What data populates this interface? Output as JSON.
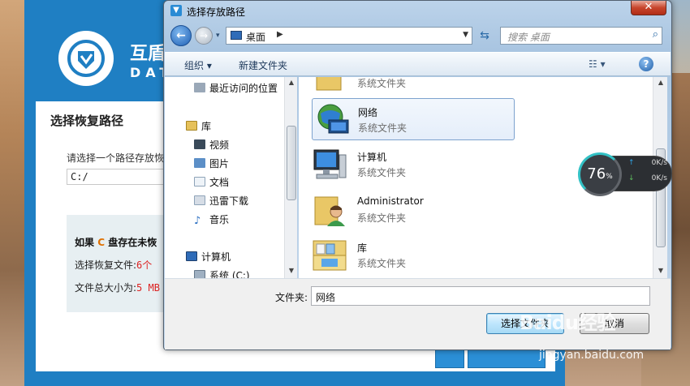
{
  "background_app": {
    "brand_title": "互盾",
    "brand_sub": "DAT",
    "panel_title": "选择恢复路径",
    "prompt": "请选择一个路径存放恢",
    "path_value": "C:/",
    "warning_prefix": "如果",
    "warning_drive": "C",
    "warning_suffix": "盘存在未恢",
    "files_label": "选择恢复文件:",
    "files_count": "6个",
    "size_label": "文件总大小为:",
    "size_value": "5 MB"
  },
  "dialog": {
    "title": "选择存放路径",
    "close_glyph": "✕",
    "address_text": "桌面",
    "search_placeholder": "搜索 桌面",
    "toolbar": {
      "organize": "组织 ▾",
      "new_folder": "新建文件夹",
      "help": "?"
    },
    "nav_items": [
      {
        "label": "最近访问的位置"
      },
      {
        "label": "库"
      },
      {
        "label": "视频"
      },
      {
        "label": "图片"
      },
      {
        "label": "文档"
      },
      {
        "label": "迅雷下载"
      },
      {
        "label": "音乐"
      },
      {
        "label": "计算机"
      },
      {
        "label": "系统 (C:)"
      }
    ],
    "files": [
      {
        "name": "",
        "type": "系统文件夹"
      },
      {
        "name": "网络",
        "type": "系统文件夹"
      },
      {
        "name": "计算机",
        "type": "系统文件夹"
      },
      {
        "name": "Administrator",
        "type": "系统文件夹"
      },
      {
        "name": "库",
        "type": "系统文件夹"
      }
    ],
    "folder_label": "文件夹:",
    "folder_value": "网络",
    "select_button": "选择文件夹",
    "cancel_button": "取消"
  },
  "speed_widget": {
    "percent": "76",
    "percent_unit": "%",
    "upload": "0K/s",
    "download": "0K/s"
  },
  "watermark": {
    "line1": "Baidu经验",
    "line2": "jingyan.baidu.com"
  }
}
